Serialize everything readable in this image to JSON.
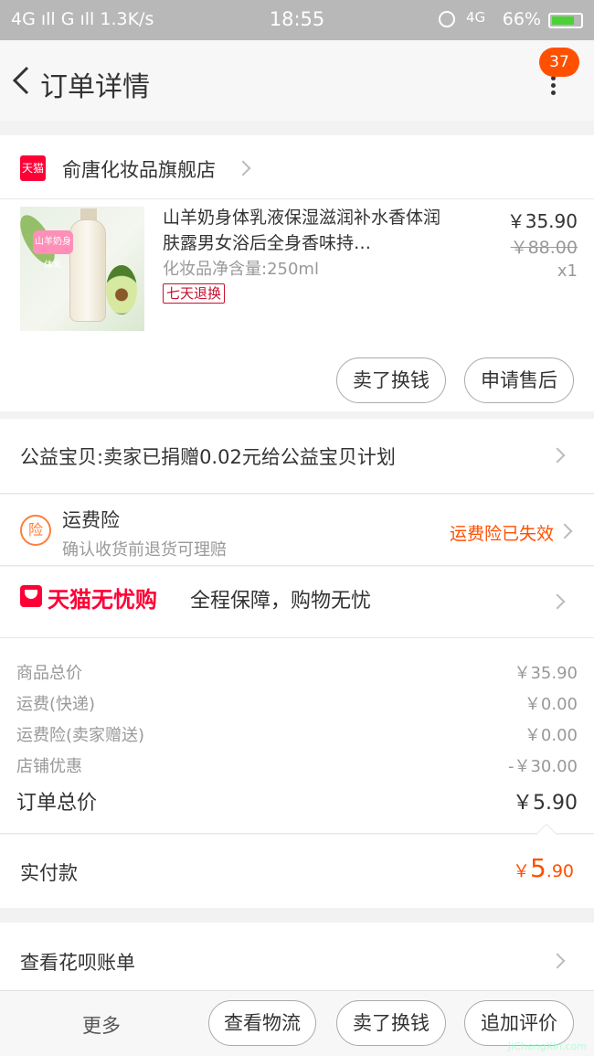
{
  "status_bar": {
    "left": "4G ıll G ıll 1.3K/s",
    "time": "18:55",
    "network": "4G",
    "battery": "66%"
  },
  "header": {
    "title": "订单详情",
    "badge_count": "37"
  },
  "shop": {
    "logo_text": "天猫",
    "name": "俞唐化妆品旗舰店"
  },
  "product": {
    "image_text": "山羊奶身体乳",
    "title": "山羊奶身体乳液保湿滋润补水香体润肤露男女浴后全身香味持…",
    "spec": "化妆品净含量:250ml",
    "tag": "七天退换",
    "price": "￥35.90",
    "original_price": "￥88.00",
    "quantity": "x1"
  },
  "item_actions": {
    "sell": "卖了换钱",
    "after_sale": "申请售后"
  },
  "charity": {
    "text": "公益宝贝:卖家已捐赠0.02元给公益宝贝计划"
  },
  "insurance": {
    "icon_text": "险",
    "title": "运费险",
    "subtitle": "确认收货前退货可理赔",
    "status": "运费险已失效"
  },
  "tmall_guarantee": {
    "brand": "天猫无忧购",
    "text": "全程保障，购物无忧"
  },
  "summary": {
    "rows": [
      {
        "label": "商品总价",
        "value": "￥35.90"
      },
      {
        "label": "运费(快递)",
        "value": "￥0.00"
      },
      {
        "label": "运费险(卖家赠送)",
        "value": "￥0.00"
      },
      {
        "label": "店铺优惠",
        "value": "-￥30.00"
      }
    ],
    "total_label": "订单总价",
    "total_value": "￥5.90"
  },
  "paid": {
    "label": "实付款",
    "currency": "￥",
    "integer": "5",
    "decimal": ".90"
  },
  "huabei": {
    "text": "查看花呗账单"
  },
  "bottom_bar": {
    "more": "更多",
    "logistics": "查看物流",
    "sell": "卖了换钱",
    "review": "追加评价"
  },
  "watermark": "JiChengXin.com",
  "colors": {
    "accent": "#ff5000",
    "tmall_red": "#ff0036"
  }
}
